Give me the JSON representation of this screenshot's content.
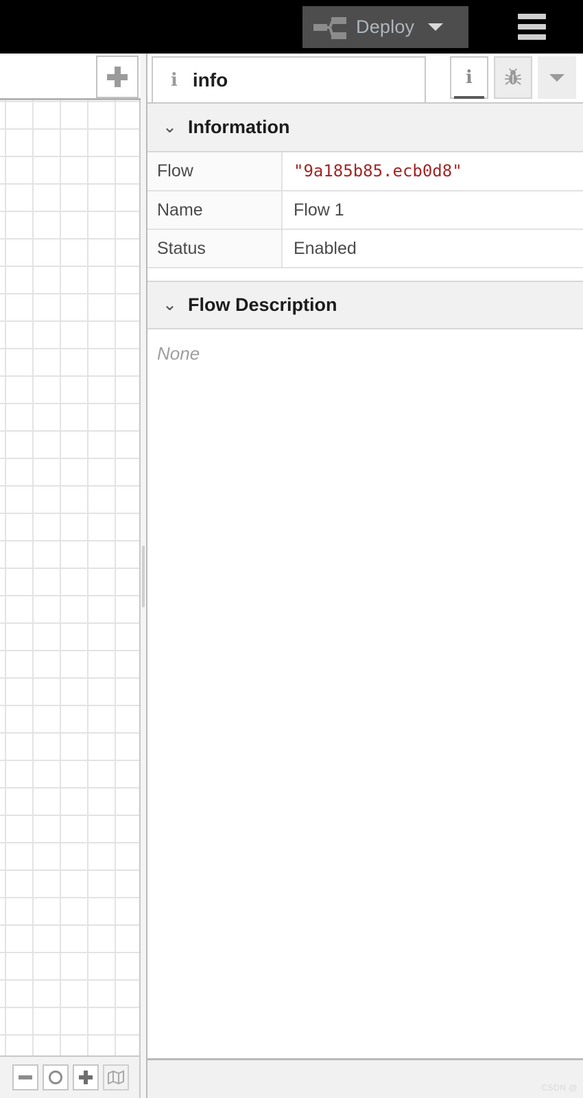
{
  "header": {
    "deploy_label": "Deploy",
    "deploy_icon": "deploy-flow-icon",
    "deploy_caret_icon": "chevron-down-icon",
    "menu_icon": "hamburger-menu-icon",
    "background_color": "#000000",
    "deploy_button_color": "#4d4d4d",
    "deploy_text_color": "#aeb6bd"
  },
  "workspace": {
    "add_tab_icon": "plus-icon",
    "add_tab_label": "+",
    "grid_size_px": 40,
    "footer": {
      "zoom_out_icon": "minus-icon",
      "zoom_reset_icon": "circle-icon",
      "zoom_in_icon": "plus-icon",
      "navigator_icon": "map-icon"
    }
  },
  "sidebar": {
    "tab": {
      "icon": "info-icon",
      "label": "info"
    },
    "actions": [
      {
        "name": "info-button",
        "icon": "info-icon",
        "active": true
      },
      {
        "name": "debug-button",
        "icon": "bug-icon",
        "active": false
      },
      {
        "name": "more-button",
        "icon": "chevron-down-icon",
        "active": false
      }
    ],
    "sections": [
      {
        "title": "Information",
        "chevron_icon": "chevron-down-icon",
        "rows": [
          {
            "key": "Flow",
            "value": "\"9a185b85.ecb0d8\"",
            "style": "mono-red"
          },
          {
            "key": "Name",
            "value": "Flow 1",
            "style": "plain"
          },
          {
            "key": "Status",
            "value": "Enabled",
            "style": "plain"
          }
        ]
      },
      {
        "title": "Flow Description",
        "chevron_icon": "chevron-down-icon",
        "empty_text": "None"
      }
    ]
  },
  "watermark": {
    "text": "CSDN @"
  },
  "colors": {
    "flow_id_red": "#a32525",
    "section_header_bg": "#f1f1f1",
    "grid_line": "#e3e3e3",
    "panel_border": "#b9b9b9"
  }
}
